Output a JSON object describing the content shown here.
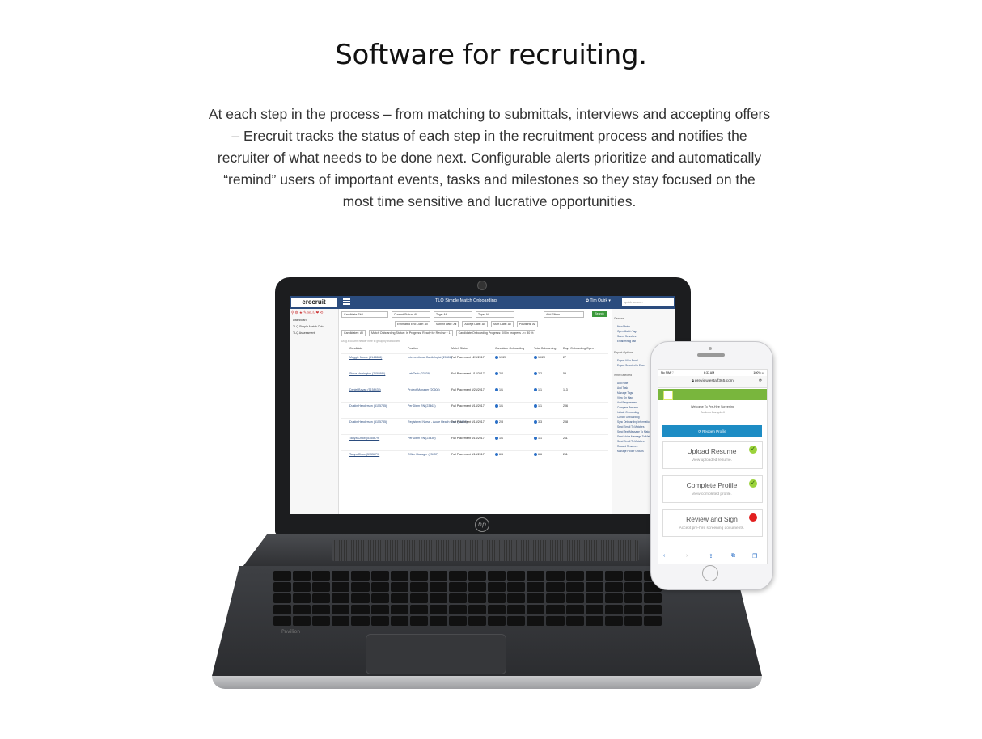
{
  "headline": "Software for recruiting.",
  "intro": "At each step in the process – from matching to submittals, interviews and accepting offers – Erecruit tracks the status of each step in the recruitment process and notifies the recruiter of what needs to be done next. Configurable alerts prioritize and automatically “remind” users of important events, tasks and milestones so they stay focused on the most time sensitive and lucrative opportunities.",
  "laptop": {
    "brand": "Pavilion",
    "app": {
      "logo": "erecruit",
      "title": "TLQ Simple Match Onboarding",
      "user": "✿ Tim Quirk ▾",
      "quick_search_placeholder": "quick search",
      "nav_icons": "⚲ ⚙ ★ ✎ ✉ ⚠ ❤ ⟲",
      "nav_items": [
        "Dashboard",
        "TLQ Simple Match Onb...",
        "TLQ Assessment"
      ],
      "filters_row1": [
        "Candidate Skill...",
        "Current Status: All",
        "Tags: All",
        "Type: All",
        "Add Filters..."
      ],
      "search_label": "Search",
      "filters_row2": [
        "Estimated End Date: All",
        "Submit Date: All",
        "Accept Date: All",
        "Start Date: All",
        "Positions: All"
      ],
      "filters_row3": [
        "Candidates: All",
        "Match Onboarding Status: In Progress, Ready for Review + 1",
        "Candidate Onboarding Progress: 0/0 in progress ->= 80 %"
      ],
      "group_hint": "Drag a column header here to group by that column",
      "columns": [
        "Candidate",
        "Position",
        "Match Status",
        "Candidate Onboarding",
        "Total Onboarding",
        "Days Onboarding Open ▾"
      ],
      "rows": [
        {
          "candidate": "Maggie Moore (5143888)",
          "position": "Interventional Cardiologist (20408)",
          "status": "Full Placement 12/9/2017",
          "cand_onb": "19/20",
          "total_onb": "19/20",
          "days": "27"
        },
        {
          "candidate": "Steve Harrington (2150881)",
          "position": "Lab Tech (23439)",
          "status": "Full Placement 1/12/2017",
          "cand_onb": "2/2",
          "total_onb": "2/2",
          "days": "59"
        },
        {
          "candidate": "Daniel Bayan (5158435)",
          "position": "Project Manager (20608)",
          "status": "Full Placement 5/26/2017",
          "cand_onb": "1/1",
          "total_onb": "1/1",
          "days": "113"
        },
        {
          "candidate": "Dustin Henderson (5155735)",
          "position": "Per Diem RN (23463)",
          "status": "Full Placement 6/13/2017",
          "cand_onb": "1/1",
          "total_onb": "1/1",
          "days": "206"
        },
        {
          "candidate": "Dustin Henderson (5155735)",
          "position": "Registered Nurse - Acute Health Care (23463)",
          "status": "Full Placement 6/15/2017",
          "cand_onb": "2/3",
          "total_onb": "3/3",
          "days": "208"
        },
        {
          "candidate": "Tanya Chow (5155679)",
          "position": "Per Diem RN (23430)",
          "status": "Full Placement 6/16/2017",
          "cand_onb": "1/1",
          "total_onb": "1/1",
          "days": "211"
        },
        {
          "candidate": "Tanya Chow (5155679)",
          "position": "Office Manager (23437)",
          "status": "Full Placement 6/15/2017",
          "cand_onb": "6/6",
          "total_onb": "6/6",
          "days": "211"
        }
      ],
      "panel": {
        "general_title": "General",
        "general_items": [
          "New Match",
          "Open Match Tags",
          "Saved Searches",
          "Email Hiring List"
        ],
        "export_title": "Export Options",
        "export_items": [
          "Export All to Excel",
          "Export Selected to Excel"
        ],
        "selected_title": "With Selected",
        "selected_items": [
          "Add Note",
          "Add Task",
          "Manage Tags",
          "View On Map",
          "Add Requirement",
          "Compare Resume",
          "Initiate Onboarding",
          "Cancel Onboarding",
          "Sync Onboarding Information",
          "Send Email To Matches",
          "Send Text Message To Matches",
          "Send Voice Message To Matches",
          "Send Email To Matches",
          "Reward Resumes",
          "Manage Folder Groups"
        ]
      }
    }
  },
  "phone": {
    "status_left": "No SIM ⌔",
    "status_center": "6:37 AM",
    "status_right": "100% ▭",
    "url": "preview.estaff365.com",
    "welcome": "Welcome To Pre-Hire Screening",
    "person": "Andrea Campbell",
    "reopen_label": "⟳ Reopen Profile",
    "cards": [
      {
        "title": "Upload Resume",
        "subtitle": "View uploaded resume.",
        "state": "done"
      },
      {
        "title": "Complete Profile",
        "subtitle": "View completed profile.",
        "state": "done"
      },
      {
        "title": "Review and Sign",
        "subtitle": "Accept pre-hire screening documents.",
        "state": "pending"
      }
    ],
    "colors": {
      "done": "#9bd33b",
      "pending": "#e22020",
      "accent": "#1d8cc4",
      "band": "#79b63d"
    }
  }
}
